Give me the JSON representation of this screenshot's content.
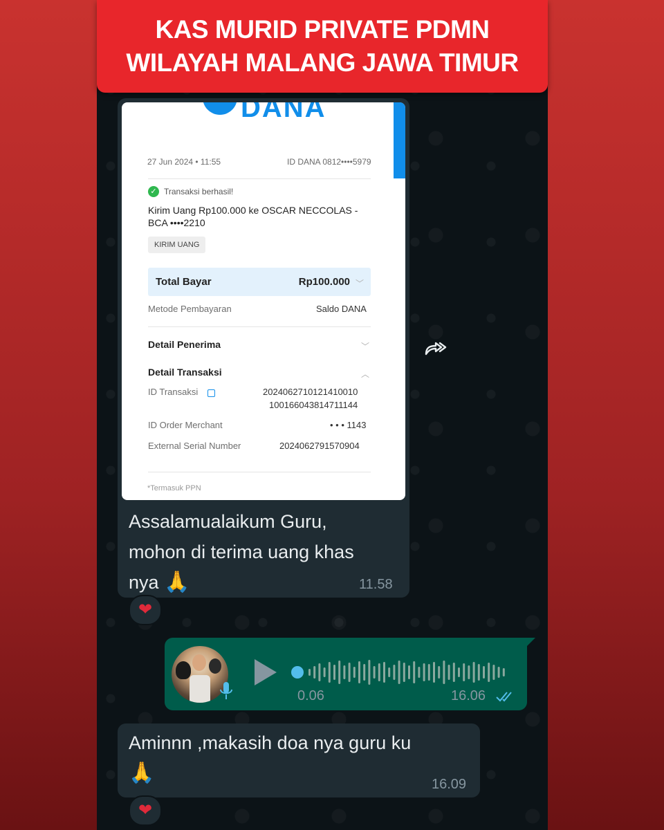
{
  "banner": {
    "line1": "KAS MURID PRIVATE PDMN",
    "line2": "WILAYAH MALANG JAWA TIMUR"
  },
  "receipt": {
    "brand": "DANA",
    "date": "27 Jun 2024 • 11:55",
    "dana_id": "ID DANA 0812••••5979",
    "status": "Transaksi berhasil!",
    "description_line1": "Kirim Uang Rp100.000 ke OSCAR NECCOLAS -",
    "description_line2": "BCA ••••2210",
    "chip": "KIRIM UANG",
    "total_label": "Total Bayar",
    "total_value": "Rp100.000",
    "payment_method_label": "Metode Pembayaran",
    "payment_method_value": "Saldo DANA",
    "recipient_detail": "Detail Penerima",
    "transaction_detail": "Detail Transaksi",
    "transaction_id_label": "ID Transaksi",
    "transaction_id_line1": "2024062710121410010",
    "transaction_id_line2": "100166043814711144",
    "order_id_label": "ID Order Merchant",
    "order_id_value": "• • • 1143",
    "serial_label": "External Serial Number",
    "serial_value": "2024062791570904",
    "footnote": "*Termasuk PPN"
  },
  "message1": {
    "text_line1": "Assalamualaikum Guru,",
    "text_line2": "mohon di terima uang khas",
    "text_line3": "nya",
    "emoji": "🙏",
    "time": "11.58",
    "reaction": "❤"
  },
  "voice": {
    "duration": "0.06",
    "time": "16.06",
    "progress": 0.0
  },
  "message2": {
    "text_line1": "Aminnn ,makasih doa nya guru ku",
    "emoji": "🙏",
    "time": "16.09",
    "reaction": "❤"
  },
  "colors": {
    "banner": "#e8262b",
    "chat_bg": "#0c1317",
    "incoming": "#1f2c33",
    "outgoing": "#005c4b",
    "dana_blue": "#118eea"
  }
}
